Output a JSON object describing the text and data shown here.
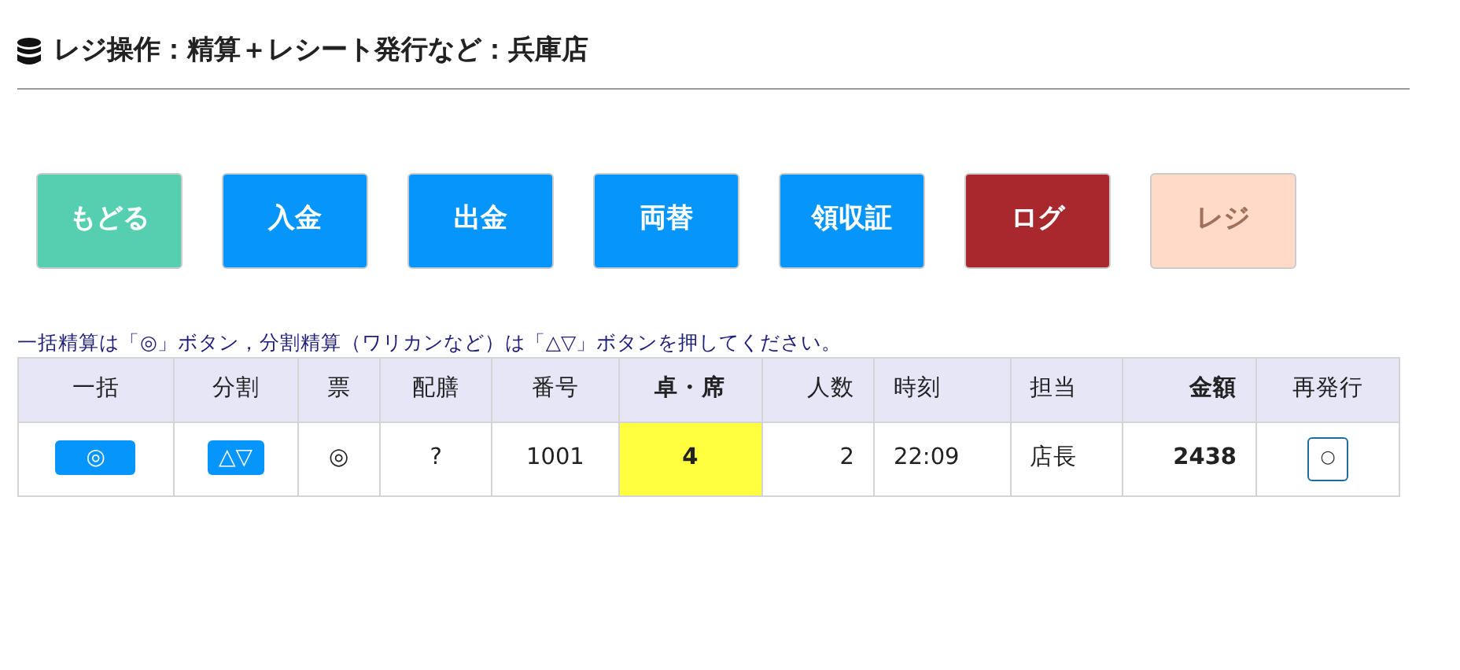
{
  "title": "レジ操作：精算＋レシート発行など：兵庫店",
  "buttons": [
    {
      "label": "もどる",
      "color": "#55cfb0"
    },
    {
      "label": "入金",
      "color": "#0595fb"
    },
    {
      "label": "出金",
      "color": "#0595fb"
    },
    {
      "label": "両替",
      "color": "#0595fb"
    },
    {
      "label": "領収証",
      "color": "#0595fb"
    },
    {
      "label": "ログ",
      "color": "#a8282e"
    },
    {
      "label": "レジ",
      "color": "#ffdac8"
    }
  ],
  "note": "一括精算は「◎」ボタン，分割精算（ワリカンなど）は「△▽」ボタンを押してください。",
  "table": {
    "columns": [
      {
        "label": "一括",
        "bold": false
      },
      {
        "label": "分割",
        "bold": false
      },
      {
        "label": "票",
        "bold": false
      },
      {
        "label": "配膳",
        "bold": false
      },
      {
        "label": "番号",
        "bold": false
      },
      {
        "label": "卓・席",
        "bold": true
      },
      {
        "label": "人数",
        "bold": false
      },
      {
        "label": "時刻",
        "bold": false
      },
      {
        "label": "担当",
        "bold": false
      },
      {
        "label": "金額",
        "bold": true
      },
      {
        "label": "再発行",
        "bold": false
      }
    ],
    "rows": [
      {
        "cells": [
          {
            "kind": "button",
            "text": "◎"
          },
          {
            "kind": "button",
            "text": "△▽"
          },
          {
            "kind": "text",
            "text": "◎"
          },
          {
            "kind": "text",
            "text": "?"
          },
          {
            "kind": "text",
            "text": "1001"
          },
          {
            "kind": "highlight",
            "text": "4"
          },
          {
            "kind": "text",
            "text": "2"
          },
          {
            "kind": "text",
            "text": "22:09"
          },
          {
            "kind": "text",
            "text": "店長"
          },
          {
            "kind": "text",
            "text": "2438"
          },
          {
            "kind": "outline",
            "text": "○"
          }
        ]
      }
    ]
  }
}
